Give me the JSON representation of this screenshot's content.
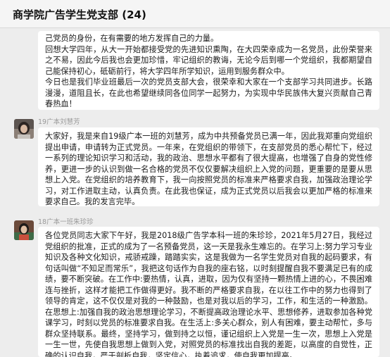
{
  "window": {
    "title": "商学院广告学生党支部 (24)"
  },
  "messages": [
    {
      "sender": "",
      "paragraphs": [
        "己党员的身份，在有需要的地方发挥自己的力量。",
        "回想大学四年，从大一开始都接受党的先进知识熏陶，在大四荣幸成为一名党员，此份荣誉来之不易，因此今后我也会更加珍惜，牢记组织的教诲，无论今后到哪一个党组织，我都期望自己能保持初心，砥砺前行，将大学四年所学知识，运用到服务群众中。",
        "今日也是我们毕业班最后一次的党员支部大会，很荣幸和大家在一个支部学习共同进步。长路漫漫，道阻且长，在此也希望继续同各位同学一起努力，为实现中华民族伟大复兴贡献自己青春热血！"
      ]
    },
    {
      "sender": "19广本刘慧芳",
      "paragraphs": [
        "大家好，我是来自19级广本一班的刘慧芳，成为中共预备党员已满一年，因此我郑重向党组织提出申请，申请转为正式党员。一年来，在党组织的带领下，在支部党员的悉心帮忙下，经过一系列的理论知识学习和活动，我的政治、思想水平都有了很大提高，也增强了自身的党性修养，更进一步的认识到做一名合格的党员不仅仅要解决组织上入党的问题，更重要的是要从思想上入党。在党组织的培养教育下，我一向按照党员的标准来严格要求自我，加强政治理论学习，对工作进取主动，认真负责。在此我也保证，成为正式党员以后我会以更加严格的标准来要求自己。我的发言完毕。"
      ]
    },
    {
      "sender": "18广本一班朱珍珍",
      "paragraphs": [
        "各位党员同志大家下午好，我是2018级广告学本科一班的朱珍珍，2021年5月27日，我经过党组织的批准，正式的成为了一名预备党员，这一天是我永生难忘的。在学习上:努力学习专业知识及各种文化知识，戒骄戒躁，踏踏实实，这是我做为一名学生党员对自我的起码要求，有句话叫做“不知足而常乐”，我把这句话作为自我的座右铭，以时刻提醒自我不要满足已有的成绩，要不断突破。在工作中:要热情，认真，进取，因为仅有坚持一颗热情上进的心，不畏困难连与挫折，这样才能把工作做得更好。我不断的严格要求自我，在以往工作中的努力也得到了领导的肯定，这不仅仅是对我的一种鼓励，也是对我以后的学习，工作，和生活的一种激励。在思想上:加强自我的政治思想理论学习，不断提高政治理论水平、思想修养，进取参加各种党课学习，时刻以党员的标准要求自我。在生活上:多关心群众，别人有困难，要主动帮忙，多与群众坚持联系。最终，坚持学习，做到持之以恒，谨记组织上入党是一生一次，思想上入党是一生一世，先使自我思想上做到入党，对照党员的标准找出自我的差距，以高度的自觉性，正确的认识自我，严于剖析自我，坚定信心，执着追求，使自我更加提高。"
      ]
    }
  ]
}
